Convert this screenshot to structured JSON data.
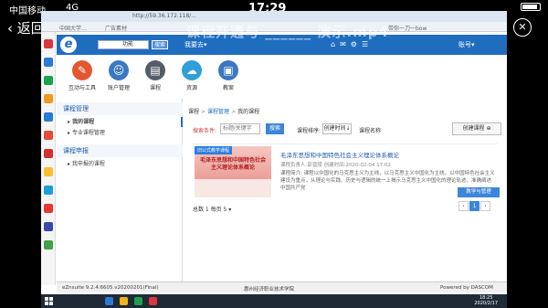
{
  "phone": {
    "carrier": "中国移动",
    "network": "4G",
    "time": "17:29",
    "back_label": "返回",
    "video_title": "课程开通与 ______ 演示.mp4",
    "close_label": "✕"
  },
  "browser": {
    "url": "http://59.36.172.118/...",
    "tabs": [
      "中国大学…",
      "广告素材",
      "带你一刀一bow"
    ]
  },
  "header": {
    "logo": "e",
    "select_value": "功能",
    "search_btn": "搜索",
    "want_go": "我要去▾",
    "account": "账号▾"
  },
  "toolbar": {
    "items": [
      {
        "label": "互动与工具",
        "color": "#e4572e",
        "glyph": "✎"
      },
      {
        "label": "账户管理",
        "color": "#3a78c2",
        "glyph": "☺"
      },
      {
        "label": "课程",
        "color": "#555d66",
        "glyph": "▤"
      },
      {
        "label": "资源",
        "color": "#2e9fd8",
        "glyph": "☁"
      },
      {
        "label": "教案",
        "color": "#3a78c2",
        "glyph": "▣"
      }
    ]
  },
  "sidebar": {
    "sections": [
      {
        "title": "课程管理",
        "items": [
          "我的课程",
          "专业课程管理"
        ]
      },
      {
        "title": "课程申报",
        "items": [
          "我申报的课程"
        ]
      }
    ]
  },
  "content": {
    "breadcrumb": [
      "课程",
      "课程管理",
      "我的课程"
    ],
    "search": {
      "label": "搜索条件:",
      "placeholder": "标题/关键字",
      "button": "搜索",
      "sort_label": "课程排序:",
      "sort_value": "创建时间↓",
      "sort_name": "课程名称",
      "create_button": "创建课程"
    },
    "course": {
      "tag": "旧公式教学课程",
      "thumb_title": "毛泽东思想和中国特色社会主义理论体系概论",
      "title": "毛泽东思想和中国特色社会主义理论体系概论",
      "meta": "课程负责人:郭晋陵  创建时间:2020-02-04 17:02",
      "description": "课程简介: 课程以中国化的马克思主义为主线，以马克思主义中国化为主线，以中国特色社会主义建设为重点，从理论与实践、历史与逻辑的统一上揭示马克思主义中国化的理论轨迹、准确阐述中国共产党",
      "manage_button": "教学与管理"
    },
    "pager": {
      "text": "总数 1 每页 5 ▾",
      "page": "1"
    }
  },
  "footer": {
    "version": "eZnsuite  9.2.4.6605.v20200201(Final)",
    "school": "惠州经济职业技术学院",
    "powered": "Powered by DASCOM"
  },
  "taskbar": {
    "time": "18:25",
    "date": "2020/2/17"
  },
  "colors": {
    "brand_blue": "#1e6dbf",
    "accent_blue": "#3b86d8"
  }
}
